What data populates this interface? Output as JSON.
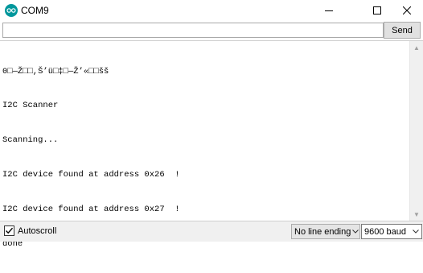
{
  "window": {
    "title": "COM9",
    "icon": "arduino-icon"
  },
  "input": {
    "value": "",
    "send_label": "Send"
  },
  "output": {
    "lines": [
      "0□—Ž□□,Š’ü□‡□—Ž’«□□šš",
      "I2C Scanner",
      "Scanning...",
      "I2C device found at address 0x26  !",
      "I2C device found at address 0x27  !",
      "done"
    ]
  },
  "footer": {
    "autoscroll_label": "Autoscroll",
    "autoscroll_checked": true,
    "line_ending": "No line ending",
    "baud": "9600 baud"
  }
}
